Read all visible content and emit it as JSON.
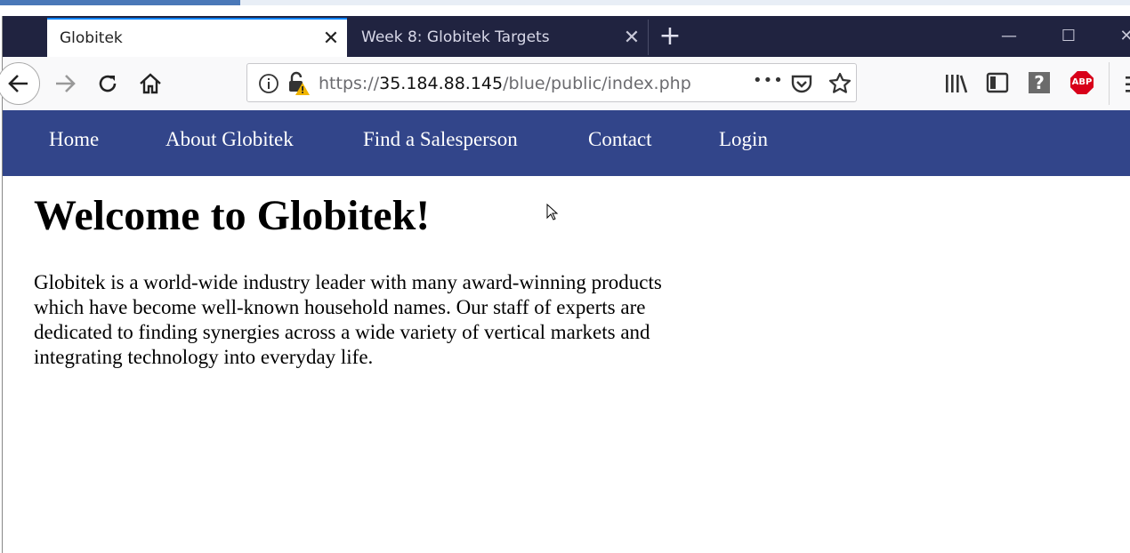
{
  "tabs": [
    {
      "title": "Globitek",
      "active": true
    },
    {
      "title": "Week 8: Globitek Targets",
      "active": false
    }
  ],
  "window_controls": {
    "minimize": "—",
    "maximize": "☐",
    "close": "✕"
  },
  "url": {
    "scheme": "https://",
    "host": "35.184.88.145",
    "path": "/blue/public/index.php"
  },
  "icons": {
    "new_tab": "+",
    "page_actions": "•••",
    "abp": "ABP",
    "help": "?"
  },
  "site_nav": [
    "Home",
    "About Globitek",
    "Find a Salesperson",
    "Contact",
    "Login"
  ],
  "page": {
    "heading": "Welcome to Globitek!",
    "paragraph": "Globitek is a world-wide industry leader with many award-winning products which have become well-known household names. Our staff of experts are dedicated to finding synergies across a wide variety of vertical markets and integrating technology into everyday life."
  },
  "colors": {
    "nav_bg": "#32458a",
    "tabbar_bg": "#202340",
    "abp_red": "#d8001a"
  }
}
